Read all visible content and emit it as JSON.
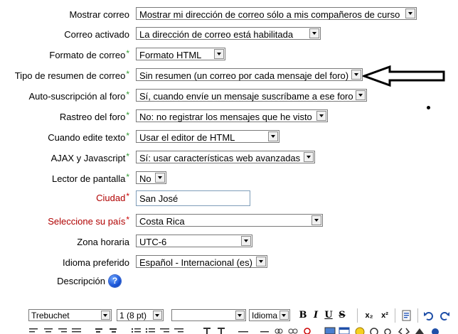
{
  "form": {
    "fields": [
      {
        "label": "Mostrar correo",
        "required": false,
        "value": "Mostrar mi dirección de correo sólo a mis compañeros de curso"
      },
      {
        "label": "Correo activado",
        "required": false,
        "value": "La dirección de correo está habilitada"
      },
      {
        "label": "Formato de correo",
        "required": true,
        "value": "Formato HTML"
      },
      {
        "label": "Tipo de resumen de correo",
        "required": true,
        "value": "Sin resumen (un correo por cada mensaje del foro)"
      },
      {
        "label": "Auto-suscripción al foro",
        "required": true,
        "value": "Sí, cuando envíe un mensaje suscríbame a ese foro"
      },
      {
        "label": "Rastreo del foro",
        "required": true,
        "value": "No: no registrar los mensajes que he visto"
      },
      {
        "label": "Cuando edite texto",
        "required": true,
        "value": "Usar el editor de HTML"
      },
      {
        "label": "AJAX y Javascript",
        "required": true,
        "value": "Sí: usar características web avanzadas"
      },
      {
        "label": "Lector de pantalla",
        "required": true,
        "value": "No"
      },
      {
        "label": "Ciudad",
        "required": true,
        "value": "San José"
      },
      {
        "label": "Seleccione su país",
        "required": true,
        "value": "Costa Rica"
      },
      {
        "label": "Zona horaria",
        "required": false,
        "value": "UTC-6"
      },
      {
        "label": "Idioma preferido",
        "required": false,
        "value": "Español - Internacional (es)"
      },
      {
        "label": "Descripción",
        "required": false,
        "value": ""
      }
    ],
    "required_mark": "*",
    "help_glyph": "?"
  },
  "editor_toolbar": {
    "font_family": "Trebuchet",
    "font_size": "1 (8 pt)",
    "style": "",
    "language": "Idioma",
    "bold": "B",
    "italic": "I",
    "underline": "U",
    "strike": "S",
    "subscript": "x₂",
    "superscript": "x²"
  },
  "colors": {
    "required_green": "#2e9a2e",
    "required_red": "#cc0000",
    "label_red": "#b00000"
  }
}
